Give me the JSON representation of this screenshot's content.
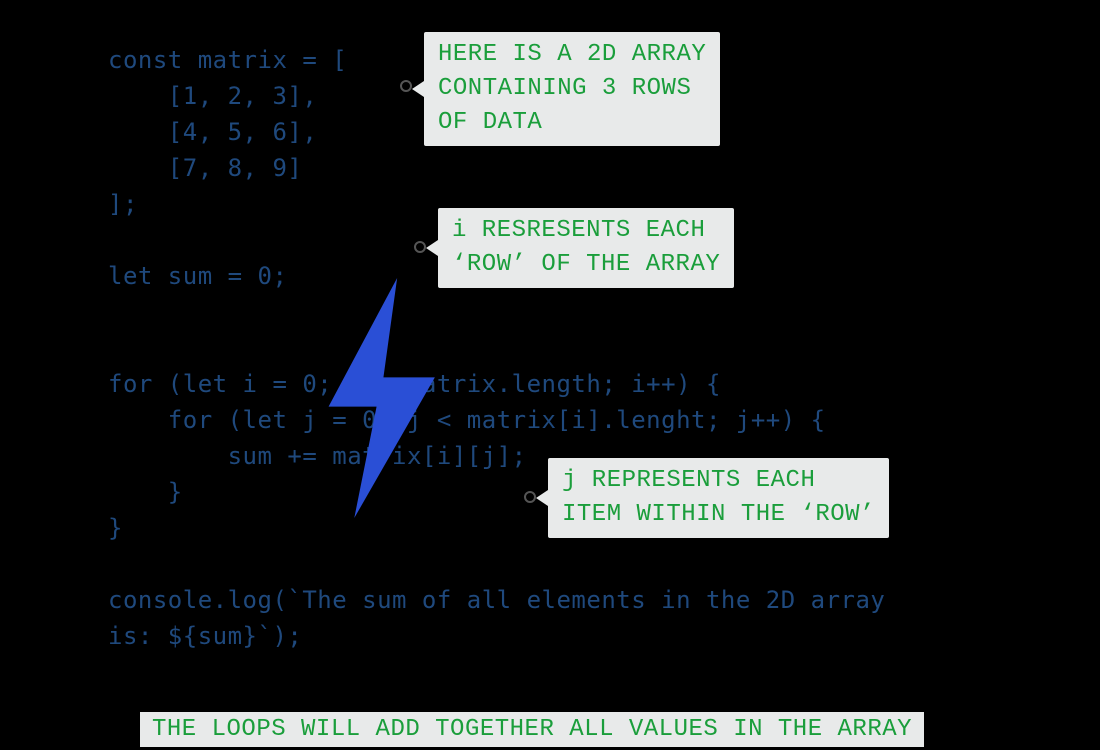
{
  "code": {
    "lines": [
      "const matrix = [",
      "    [1, 2, 3],",
      "    [4, 5, 6],",
      "    [7, 8, 9]",
      "];",
      "",
      "let sum = 0;",
      "",
      "",
      "for (let i = 0; i < matrix.length; i++) {",
      "    for (let j = 0; j < matrix[i].lenght; j++) {",
      "        sum += matrix[i][j];",
      "    }",
      "}",
      "",
      "console.log(`The sum of all elements in the 2D array",
      "is: ${sum}`);"
    ]
  },
  "callouts": {
    "c1_line1": "HERE IS A 2D ARRAY",
    "c1_line2": "CONTAINING 3 ROWS",
    "c1_line3": "OF DATA",
    "c2_line1": "i RESRESENTS EACH",
    "c2_line2": "‘ROW’ OF THE ARRAY",
    "c3_line1": "j REPRESENTS EACH",
    "c3_line2": "ITEM WITHIN THE ‘ROW’",
    "bottom": "THE LOOPS WILL ADD TOGETHER ALL VALUES IN THE ARRAY"
  },
  "colors": {
    "code": "#1f497d",
    "callout_bg": "#e8eaea",
    "callout_text": "#1a9e3b",
    "bolt": "#2a4fd6",
    "background": "#000000"
  }
}
